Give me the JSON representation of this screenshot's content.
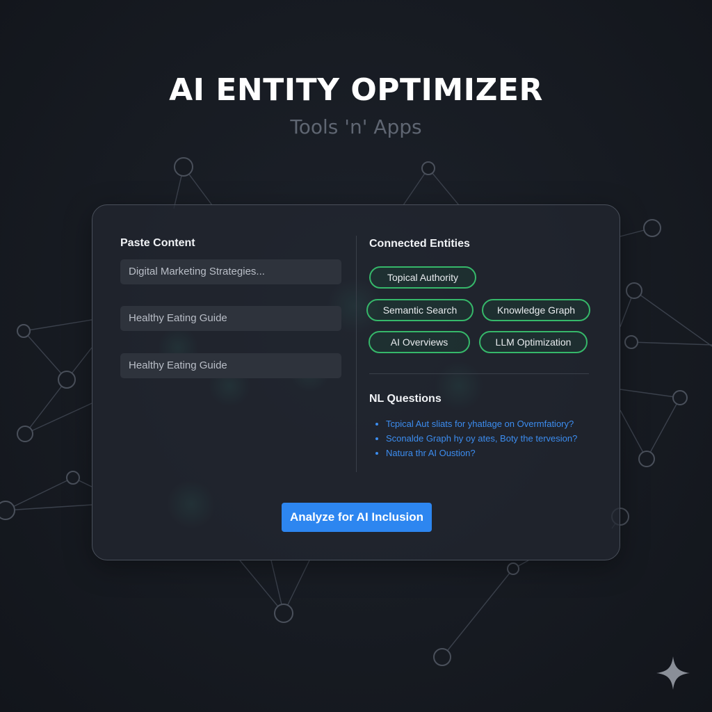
{
  "header": {
    "title": "AI ENTITY OPTIMIZER",
    "subtitle": "Tools 'n' Apps"
  },
  "paste_content": {
    "label": "Paste Content",
    "inputs": [
      {
        "value": "Digital Marketing Strategies..."
      },
      {
        "value": "Healthy Eating Guide"
      },
      {
        "value": "Healthy Eating Guide"
      }
    ]
  },
  "connected_entities": {
    "label": "Connected Entities",
    "entities": [
      {
        "label": "Topical Authority"
      },
      {
        "label": "Semantic Search"
      },
      {
        "label": "Knowledge Graph"
      },
      {
        "label": "AI Overviews"
      },
      {
        "label": "LLM Optimization"
      }
    ]
  },
  "nl_questions": {
    "label": "NL Questions",
    "items": [
      {
        "text": "Tcpical Aut sliats for yhatlage on Overmfatiory?"
      },
      {
        "text": "Sconalde Graph hy oy ates, Boty the tervesion?"
      },
      {
        "text": "Natura thr AI Oustion?"
      }
    ]
  },
  "actions": {
    "analyze_label": "Analyze for AI Inclusion"
  },
  "icons": {
    "watermark": "sparkle-icon"
  },
  "colors": {
    "background": "#171b22",
    "accent_green": "#36b86a",
    "accent_blue": "#2d86f0",
    "question_text": "#3c8df0"
  }
}
